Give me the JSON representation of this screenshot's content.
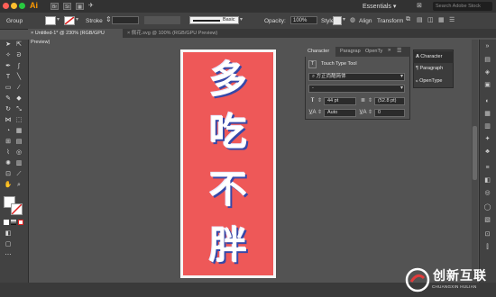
{
  "app": {
    "logo": "Ai",
    "bridge": "Br",
    "stock": "St",
    "workspace": "Essentials",
    "search_placeholder": "Search Adobe Stock"
  },
  "control_bar": {
    "selection": "Group",
    "stroke_label": "Stroke",
    "brush": "Basic",
    "opacity_label": "Opacity:",
    "opacity_value": "100%",
    "style_label": "Style:",
    "align": "Align",
    "transform": "Transform"
  },
  "tabs": [
    {
      "label": "Untitled-1* @ 230% (RGB/GPU Preview)",
      "active": true
    },
    {
      "label": "佩花.svg @ 100% (RGB/GPU Preview)",
      "active": false
    }
  ],
  "artwork": {
    "lines": [
      "多",
      "吃",
      "不",
      "胖"
    ],
    "background_color": "#ee5858",
    "text_color": "#ffffff",
    "shadow_color": "#3648a8"
  },
  "character_panel": {
    "tabs": [
      "Character",
      "Paragrap",
      "OpenTy"
    ],
    "touch_type_tool": "Touch Type Tool",
    "font_family": "方正尚酷简体",
    "font_style": "-",
    "font_size": "44 pt",
    "leading": "(52.8 pt)",
    "kerning": "Auto",
    "tracking": "0"
  },
  "dock": {
    "items": [
      "Character",
      "Paragraph",
      "OpenType"
    ]
  },
  "watermark": {
    "text": "创新互联",
    "sub": "CHUANGXIN HULIAN"
  }
}
